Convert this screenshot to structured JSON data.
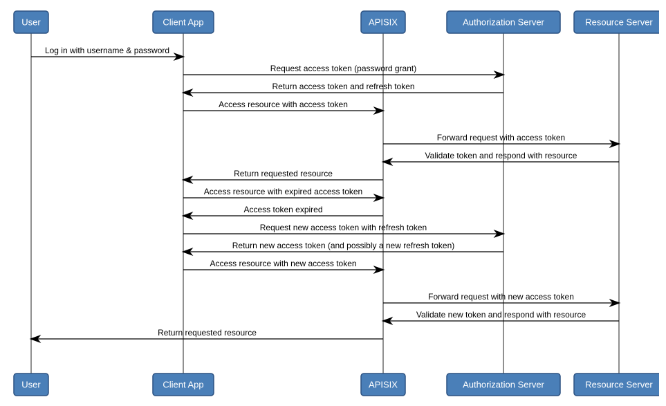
{
  "participants": {
    "user": "User",
    "client": "Client App",
    "apisix": "APISIX",
    "auth": "Authorization Server",
    "resource": "Resource Server"
  },
  "messages": {
    "m1": "Log in with username & password",
    "m2": "Request access token (password grant)",
    "m3": "Return access token and refresh token",
    "m4": "Access resource with access token",
    "m5": "Forward request with access token",
    "m6": "Validate token and respond with resource",
    "m7": "Return requested resource",
    "m8": "Access resource with expired access token",
    "m9": "Access token expired",
    "m10": "Request new access token with refresh token",
    "m11": "Return new access token (and possibly a new refresh token)",
    "m12": "Access resource with new access token",
    "m13": "Forward request with new access token",
    "m14": "Validate new token and respond with resource",
    "m15": "Return requested resource"
  },
  "geom": {
    "lanes": {
      "user": 35,
      "client": 255,
      "apisix": 544,
      "auth": 718,
      "resource": 885
    },
    "boxW": {
      "user": 50,
      "client": 88,
      "apisix": 64,
      "auth": 164,
      "resource": 130
    },
    "boxH": 32,
    "topBoxY": 6,
    "botBoxY": 530,
    "lifelineTop": 38,
    "lifelineBottom": 530,
    "msgY": [
      72,
      98,
      124,
      150,
      198,
      224,
      250,
      276,
      302,
      328,
      354,
      380,
      428,
      454,
      480
    ]
  },
  "flow": [
    {
      "from": "user",
      "to": "client",
      "msg": "m1"
    },
    {
      "from": "client",
      "to": "auth",
      "msg": "m2"
    },
    {
      "from": "auth",
      "to": "client",
      "msg": "m3"
    },
    {
      "from": "client",
      "to": "apisix",
      "msg": "m4"
    },
    {
      "from": "apisix",
      "to": "resource",
      "msg": "m5"
    },
    {
      "from": "resource",
      "to": "apisix",
      "msg": "m6"
    },
    {
      "from": "apisix",
      "to": "client",
      "msg": "m7"
    },
    {
      "from": "client",
      "to": "apisix",
      "msg": "m8"
    },
    {
      "from": "apisix",
      "to": "client",
      "msg": "m9"
    },
    {
      "from": "client",
      "to": "auth",
      "msg": "m10"
    },
    {
      "from": "auth",
      "to": "client",
      "msg": "m11"
    },
    {
      "from": "client",
      "to": "apisix",
      "msg": "m12"
    },
    {
      "from": "apisix",
      "to": "resource",
      "msg": "m13"
    },
    {
      "from": "resource",
      "to": "apisix",
      "msg": "m14"
    },
    {
      "from": "apisix",
      "to": "user",
      "msg": "m15"
    }
  ]
}
